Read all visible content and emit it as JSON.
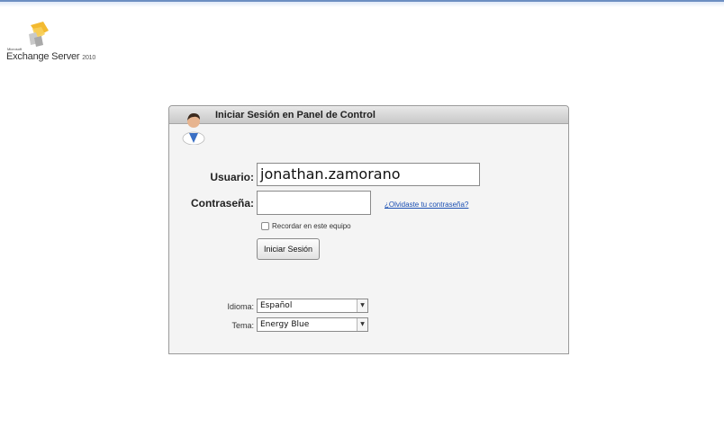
{
  "logo": {
    "microsoft": "Microsoft",
    "product": "Exchange Server",
    "version": "2010"
  },
  "panel": {
    "title": "Iniciar Sesión en Panel de Control"
  },
  "form": {
    "username_label": "Usuario:",
    "username_value": "jonathan.zamorano",
    "password_label": "Contraseña:",
    "password_value": "",
    "forgot_link": "¿Olvidaste tu contraseña?",
    "remember_label": "Recordar en este equipo",
    "remember_checked": false,
    "login_button": "Iniciar Sesión",
    "language_label": "Idioma:",
    "language_value": "Español",
    "theme_label": "Tema:",
    "theme_value": "Energy Blue"
  },
  "icons": {
    "logo": "exchange-logo-icon",
    "avatar": "user-avatar-icon",
    "dropdown": "chevron-down-icon"
  },
  "colors": {
    "link": "#1a4fb3",
    "top_bar": "#6d8fc2",
    "panel_background": "#f4f4f4"
  }
}
